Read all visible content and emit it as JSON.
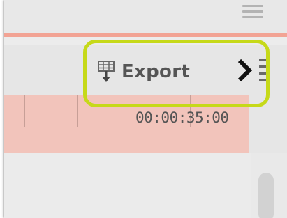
{
  "toolbar": {
    "export_label": "Export",
    "export_icon": "export-icon",
    "menu_icon": "hamburger-menu-icon",
    "chevron_icon": "chevron-right-icon"
  },
  "timeline": {
    "timecode": "00:00:35:00"
  },
  "colors": {
    "accent_line": "#f2a394",
    "timeline_fill": "#f2c4bb",
    "highlight": "#c6d919",
    "label_text": "#555555"
  }
}
